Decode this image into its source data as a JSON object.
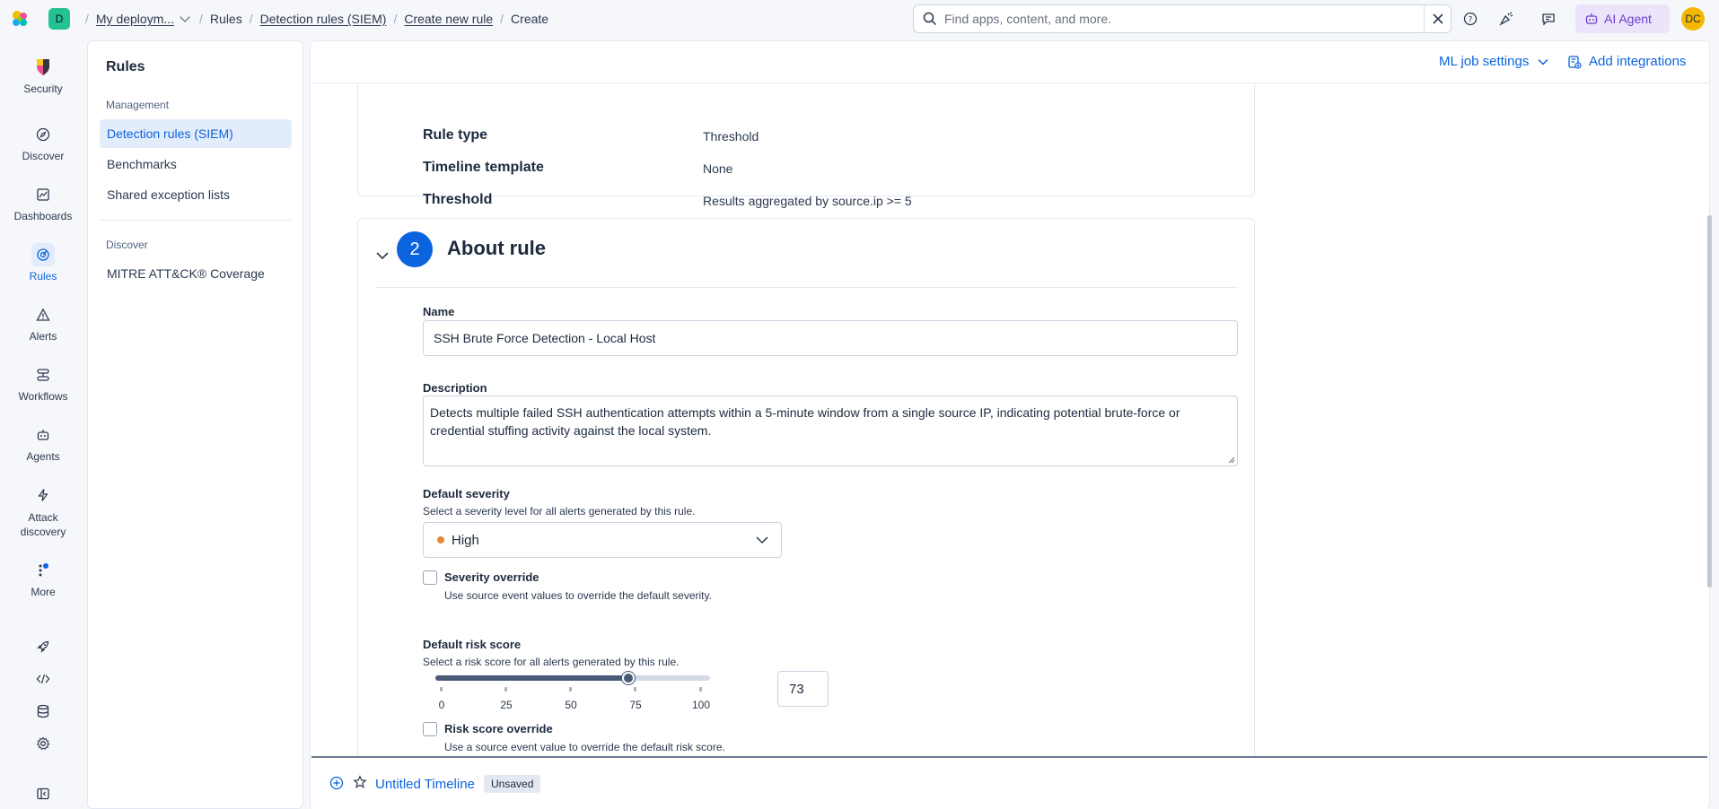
{
  "header": {
    "space_initial": "D",
    "breadcrumbs": [
      "My deploym...",
      "Rules",
      "Detection rules (SIEM)",
      "Create new rule",
      "Create"
    ],
    "search_placeholder": "Find apps, content, and more.",
    "ai_agent_label": "AI Agent",
    "user_initials": "DC"
  },
  "rail": {
    "items": [
      {
        "label": "Security",
        "icon": "security-logo-icon"
      },
      {
        "label": "Discover",
        "icon": "discover-icon"
      },
      {
        "label": "Dashboards",
        "icon": "dashboards-icon"
      },
      {
        "label": "Rules",
        "icon": "rules-icon"
      },
      {
        "label": "Alerts",
        "icon": "alerts-icon"
      },
      {
        "label": "Workflows",
        "icon": "workflows-icon"
      },
      {
        "label": "Agents",
        "icon": "agents-icon"
      },
      {
        "label": "Attack discovery",
        "icon": "attack-discovery-icon"
      },
      {
        "label": "More",
        "icon": "more-icon"
      }
    ],
    "active": "Rules"
  },
  "sidebar": {
    "title": "Rules",
    "groups": [
      {
        "label": "Management",
        "items": [
          "Detection rules (SIEM)",
          "Benchmarks",
          "Shared exception lists"
        ]
      },
      {
        "label": "Discover",
        "items": [
          "MITRE ATT&CK® Coverage"
        ]
      }
    ]
  },
  "page_header": {
    "ml_job_settings": "ML job settings",
    "add_integrations": "Add integrations"
  },
  "define_rule": {
    "rows": [
      {
        "term": "Rule type",
        "value": "Threshold"
      },
      {
        "term": "Timeline template",
        "value": "None"
      },
      {
        "term": "Threshold",
        "value": "Results aggregated by source.ip >= 5"
      }
    ]
  },
  "about_rule": {
    "step_number": "2",
    "title": "About rule",
    "name_label": "Name",
    "name_value": "SSH Brute Force Detection - Local Host",
    "description_label": "Description",
    "description_value": "Detects multiple failed SSH authentication attempts within a 5-minute window from a single source IP, indicating potential brute-force or credential stuffing activity against the local system.",
    "severity_label": "Default severity",
    "severity_help": "Select a severity level for all alerts generated by this rule.",
    "severity_value": "High",
    "severity_color": "#e7883b",
    "severity_override_label": "Severity override",
    "severity_override_help": "Use source event values to override the default severity.",
    "risk_label": "Default risk score",
    "risk_help": "Select a risk score for all alerts generated by this rule.",
    "risk_value": "73",
    "risk_ticks": [
      "0",
      "25",
      "50",
      "75",
      "100"
    ],
    "risk_override_label": "Risk score override",
    "risk_override_help": "Use a source event value to override the default risk score."
  },
  "timeline": {
    "title": "Untitled Timeline",
    "badge": "Unsaved"
  },
  "colors": {
    "accent": "#0b64dd",
    "space_badge": "#24c292",
    "avatar": "#f5b800"
  }
}
